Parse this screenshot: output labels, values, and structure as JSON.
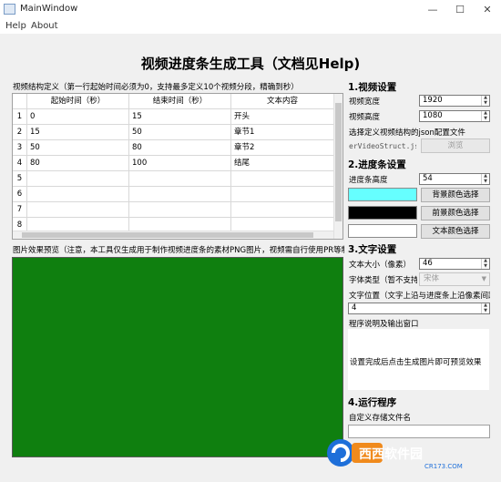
{
  "window": {
    "title": "MainWindow",
    "controls": [
      "—",
      "☐",
      "✕"
    ]
  },
  "menu": [
    "Help",
    "About"
  ],
  "heading": "视频进度条生成工具（文档见Help)",
  "structure_label": "视频结构定义（第一行起始时间必须为0，支持最多定义10个视频分段，精确到秒）",
  "table": {
    "headers": [
      "起始时间（秒）",
      "结束时间（秒）",
      "文本内容"
    ],
    "rows": [
      {
        "num": "1",
        "start": "0",
        "end": "15",
        "text": "开头"
      },
      {
        "num": "2",
        "start": "15",
        "end": "50",
        "text": "章节1"
      },
      {
        "num": "3",
        "start": "50",
        "end": "80",
        "text": "章节2"
      },
      {
        "num": "4",
        "start": "80",
        "end": "100",
        "text": "结尾"
      },
      {
        "num": "5",
        "start": "",
        "end": "",
        "text": ""
      },
      {
        "num": "6",
        "start": "",
        "end": "",
        "text": ""
      },
      {
        "num": "7",
        "start": "",
        "end": "",
        "text": ""
      },
      {
        "num": "8",
        "start": "",
        "end": "",
        "text": ""
      }
    ]
  },
  "preview_label": "图片效果预览（注意，本工具仅生成用于制作视频进度条的素材PNG图片，视频需自行使用PR等制作）",
  "video_settings": {
    "title": "1.视频设置",
    "width_label": "视频宽度",
    "width_value": "1920",
    "height_label": "视频高度",
    "height_value": "1080",
    "json_label": "选择定义视频结构的json配置文件",
    "json_value": "erVideoStruct.json",
    "browse_label": "浏览"
  },
  "progress_settings": {
    "title": "2.进度条设置",
    "height_label": "进度条高度",
    "height_value": "54",
    "bg_color": "#66ffff",
    "fg_color": "#000000",
    "text_color": "#ffffff",
    "bg_button": "背景颜色选择",
    "fg_button": "前景颜色选择",
    "text_button": "文本颜色选择"
  },
  "text_settings": {
    "title": "3.文字设置",
    "size_label": "文本大小（像素）",
    "size_value": "46",
    "font_label": "字体类型（暂不支持i",
    "font_value": "宋体",
    "pos_label": "文字位置（文字上沿与进度条上沿像素间距",
    "pos_value": "4"
  },
  "output": {
    "label": "程序说明及输出窗口",
    "message": "设置完成后点击生成图片即可预览效果"
  },
  "run": {
    "title": "4.运行程序",
    "filename_label": "自定义存储文件名",
    "filename_value": ""
  },
  "watermark": {
    "text": "西西软件园",
    "url": "CR173.COM",
    "brand_color": "#1e6fd9",
    "accent_color": "#f08a1c"
  }
}
